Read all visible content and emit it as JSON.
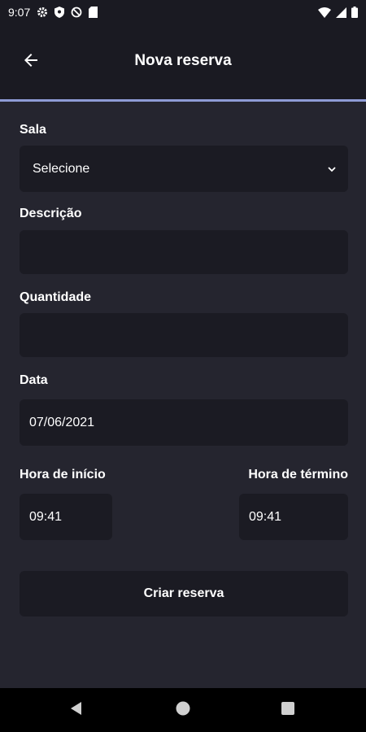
{
  "status_bar": {
    "time": "9:07",
    "icons_left": [
      "gear-icon",
      "shield-icon",
      "no-sync-icon",
      "sd-card-icon"
    ],
    "icons_right": [
      "wifi-icon",
      "signal-icon",
      "battery-icon"
    ]
  },
  "app_bar": {
    "title": "Nova reserva",
    "back_icon": "arrow-left-icon",
    "accent_color": "#8e9bd6"
  },
  "form": {
    "room": {
      "label": "Sala",
      "selected": "Selecione"
    },
    "description": {
      "label": "Descrição",
      "value": ""
    },
    "quantity": {
      "label": "Quantidade",
      "value": ""
    },
    "date": {
      "label": "Data",
      "value": "07/06/2021"
    },
    "start_time": {
      "label": "Hora de início",
      "value": "09:41"
    },
    "end_time": {
      "label": "Hora de término",
      "value": "09:41"
    },
    "submit_label": "Criar reserva"
  },
  "nav_bar": {
    "buttons": [
      "back-triangle-icon",
      "home-circle-icon",
      "recents-square-icon"
    ]
  }
}
